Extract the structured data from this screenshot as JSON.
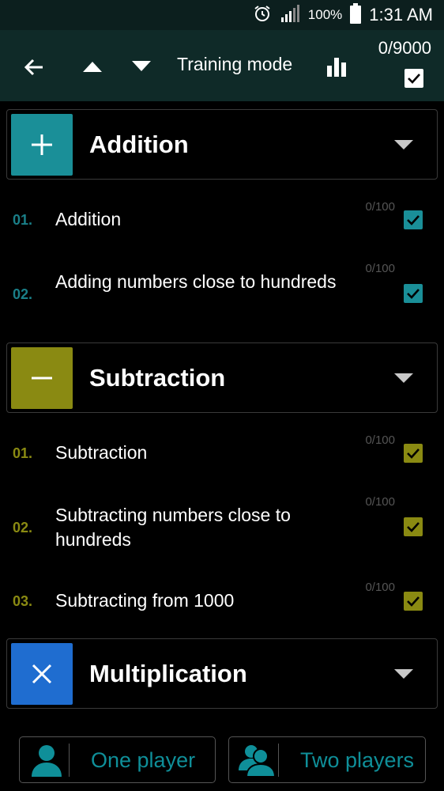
{
  "status_bar": {
    "battery_percent": "100%",
    "time": "1:31 AM",
    "icons": [
      "alarm-icon",
      "signal-icon",
      "battery-icon"
    ]
  },
  "toolbar": {
    "title": "Training mode",
    "progress": "0/9000",
    "select_all_checked": true,
    "icons": [
      "back-arrow-icon",
      "up-arrow-icon",
      "down-arrow-icon",
      "stats-icon",
      "checkbox-icon"
    ]
  },
  "sections": [
    {
      "label": "Addition",
      "symbol": "+",
      "color": "#1a8f98",
      "items": [
        {
          "num": "01.",
          "label": "Addition",
          "score": "0/100",
          "checked": true
        },
        {
          "num": "02.",
          "label": "Adding numbers close to hundreds",
          "score": "0/100",
          "checked": true
        }
      ]
    },
    {
      "label": "Subtraction",
      "symbol": "−",
      "color": "#8a8a12",
      "items": [
        {
          "num": "01.",
          "label": "Subtraction",
          "score": "0/100",
          "checked": true
        },
        {
          "num": "02.",
          "label": "Subtracting numbers close to hundreds",
          "score": "0/100",
          "checked": true
        },
        {
          "num": "03.",
          "label": "Subtracting from 1000",
          "score": "0/100",
          "checked": true
        }
      ]
    },
    {
      "label": "Multiplication",
      "symbol": "×",
      "color": "#1f6dd0",
      "items": []
    }
  ],
  "bottom": {
    "one_player": "One player",
    "two_players": "Two players",
    "accent": "#0f8f99"
  }
}
